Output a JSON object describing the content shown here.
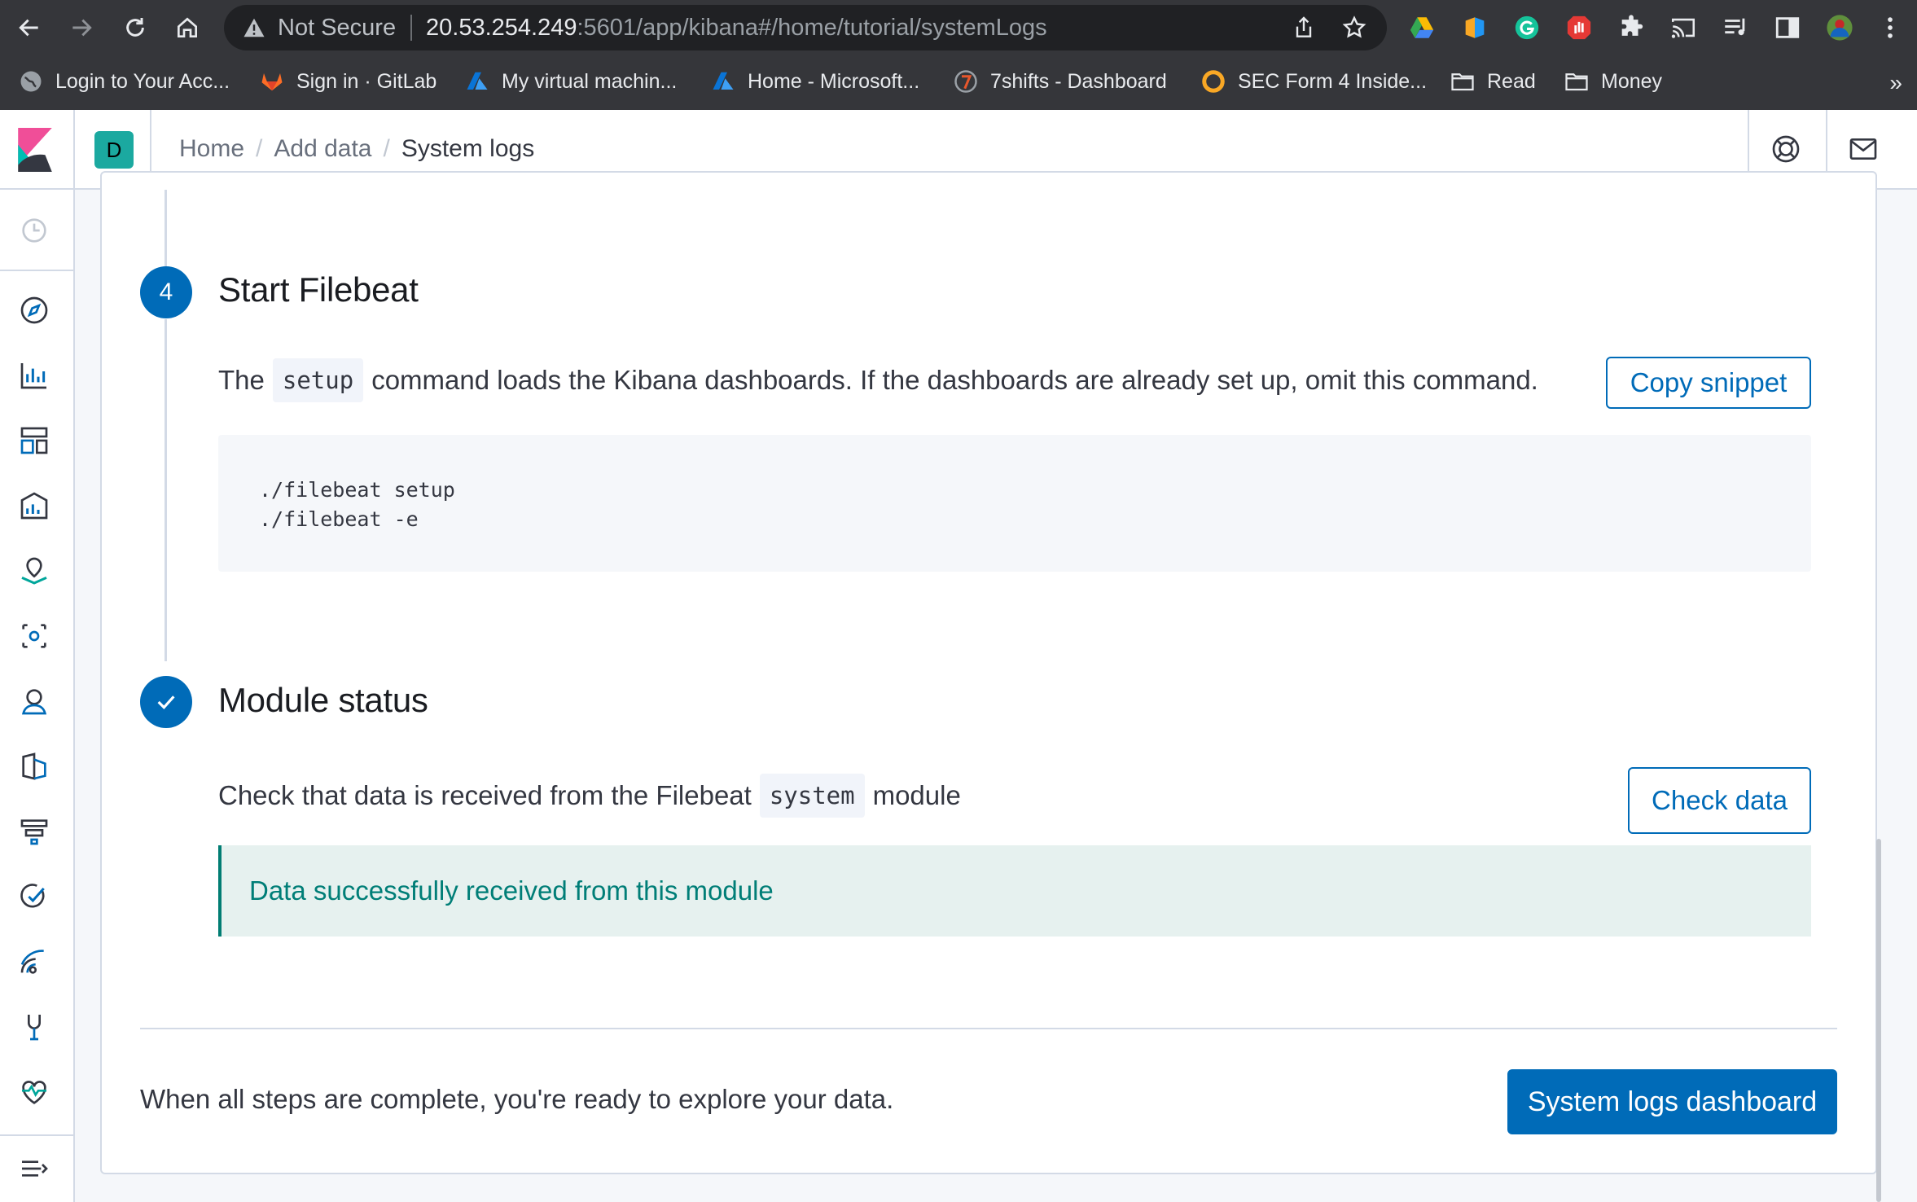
{
  "browser": {
    "security_label": "Not Secure",
    "url_host": "20.53.254.249",
    "url_path": ":5601/app/kibana#/home/tutorial/systemLogs",
    "bookmarks": [
      {
        "label": "Login to Your Acc...",
        "icon": "globe-icon"
      },
      {
        "label": "Sign in · GitLab",
        "icon": "gitlab-icon"
      },
      {
        "label": "My virtual machin...",
        "icon": "azure-icon"
      },
      {
        "label": "Home - Microsoft...",
        "icon": "azure-icon"
      },
      {
        "label": "7shifts - Dashboard",
        "icon": "7shifts-icon"
      },
      {
        "label": "SEC Form 4 Inside...",
        "icon": "sec-icon"
      },
      {
        "label": "Read",
        "icon": "folder-icon"
      },
      {
        "label": "Money",
        "icon": "folder-icon"
      }
    ],
    "bookmarks_more": "»"
  },
  "header": {
    "space_initial": "D",
    "breadcrumbs": [
      "Home",
      "Add data",
      "System logs"
    ]
  },
  "step4": {
    "number": "4",
    "title": "Start Filebeat",
    "text_before": "The",
    "code": "setup",
    "text_after": "command loads the Kibana dashboards. If the dashboards are already set up, omit this command.",
    "copy_label": "Copy snippet",
    "snippet_lines": [
      "./filebeat setup",
      "./filebeat -e"
    ]
  },
  "module_status": {
    "title": "Module status",
    "text_before": "Check that data is received from the Filebeat",
    "code": "system",
    "text_after": "module",
    "check_label": "Check data",
    "success_message": "Data successfully received from this module"
  },
  "footer": {
    "message": "When all steps are complete, you're ready to explore your data.",
    "dashboard_button": "System logs dashboard"
  },
  "colors": {
    "primary": "#006bb8",
    "success_text": "#007e77",
    "success_bg": "#e6f1ef",
    "chrome_bg": "#35363a"
  }
}
